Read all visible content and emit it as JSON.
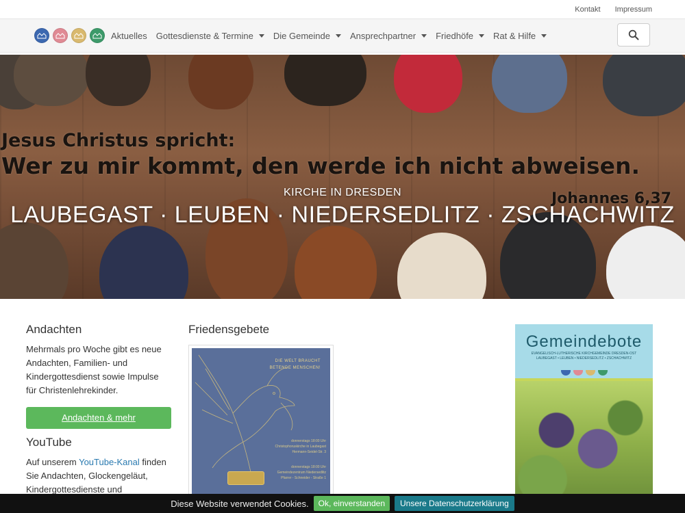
{
  "topbar": {
    "links": [
      "Kontakt",
      "Impressum"
    ]
  },
  "nav": {
    "logos": [
      {
        "name": "logo-laubegast",
        "color": "#3c68b0"
      },
      {
        "name": "logo-leuben",
        "color": "#e08a94"
      },
      {
        "name": "logo-niedersedlitz",
        "color": "#d9b96e"
      },
      {
        "name": "logo-zschachwitz",
        "color": "#3d9a6a"
      }
    ],
    "items": [
      {
        "label": "Aktuelles",
        "dropdown": false
      },
      {
        "label": "Gottesdienste & Termine",
        "dropdown": true
      },
      {
        "label": "Die Gemeinde",
        "dropdown": true
      },
      {
        "label": "Ansprechpartner",
        "dropdown": true
      },
      {
        "label": "Friedhöfe",
        "dropdown": true
      },
      {
        "label": "Rat & Hilfe",
        "dropdown": true
      }
    ],
    "search_icon": "search-icon"
  },
  "hero": {
    "quote_line1": "Jesus Christus spricht:",
    "quote_line2": "Wer zu mir kommt, den werde ich nicht abweisen.",
    "quote_ref": "Johannes 6,37",
    "subtitle": "KIRCHE IN DRESDEN",
    "title": "LAUBEGAST · LEUBEN · NIEDERSEDLITZ · ZSCHACHWITZ"
  },
  "andachten": {
    "heading": "Andachten",
    "text": "Mehrmals pro Woche gibt es neue Andachten, Familien- und Kindergottesdienst sowie Impulse für Christenlehrekinder.",
    "button": "Andachten & mehr"
  },
  "youtube": {
    "heading": "YouTube",
    "text_before": "Auf unserem ",
    "link": "YouTube-Kanal",
    "text_after": " finden Sie Andachten, Glockengeläut, Kindergottesdienste und"
  },
  "friedensgebete": {
    "heading": "Friedensgebete",
    "poster_head_line1": "DIE WELT BRAUCHT",
    "poster_head_line2": "BETENDE MENSCHEN!",
    "poster_text1_line1": "donnerstags 18:00 Uhr",
    "poster_text1_line2": "Christophoruskirche in Laubegast",
    "poster_text1_line3": "Hermann-Seidel-Str. 3",
    "poster_text2_line1": "donnerstags 18:00 Uhr",
    "poster_text2_line2": "Gemeindezentrum Niedersedlitz",
    "poster_text2_line3": "Pfarrer - Schneider - Straße 1"
  },
  "gemeindebote": {
    "title": "Gemeindebote",
    "sub1": "EVANGELISCH-LUTHERISCHE KIRCHGEMEINDE DRESDEN-OST",
    "sub2": "LAUBEGAST • LEUBEN • NIEDERSEDLITZ • ZSCHACHWITZ"
  },
  "cookie": {
    "text": "Diese Website verwendet Cookies.",
    "ok": "Ok, einverstanden",
    "privacy": "Unsere Datenschutzerklärung"
  }
}
